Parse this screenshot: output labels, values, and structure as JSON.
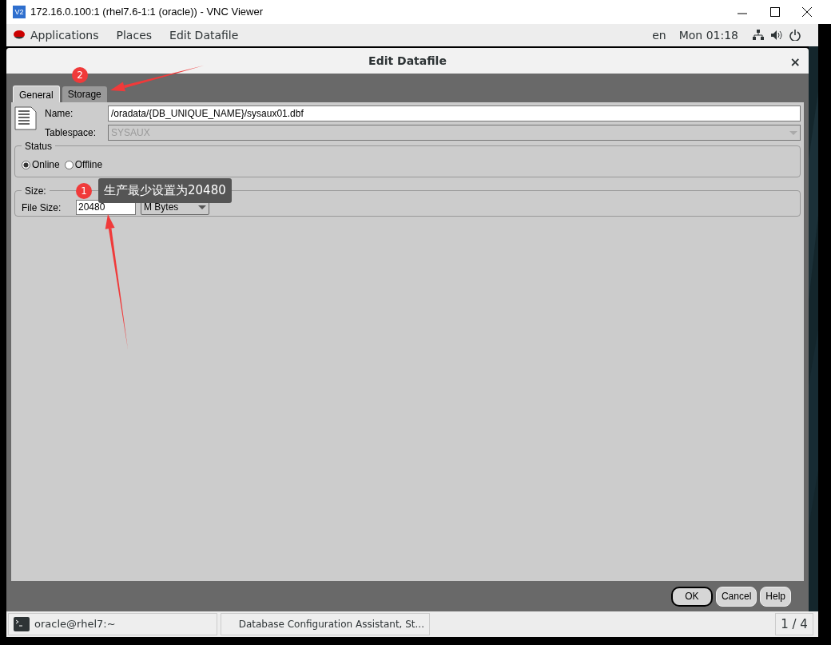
{
  "vnc_window": {
    "app_icon": "V2",
    "title": "172.16.0.100:1 (rhel7.6-1:1 (oracle)) - VNC Viewer"
  },
  "top_bar": {
    "menus": [
      "Applications",
      "Places",
      "Edit Datafile"
    ],
    "language": "en",
    "clock": "Mon 01:18"
  },
  "dialog": {
    "title": "Edit Datafile",
    "close": "×",
    "tabs": [
      {
        "label": "General",
        "selected": true
      },
      {
        "label": "Storage",
        "selected": false
      }
    ],
    "name": {
      "label": "Name:",
      "value": "/oradata/{DB_UNIQUE_NAME}/sysaux01.dbf"
    },
    "tablespace": {
      "label": "Tablespace:",
      "value": "SYSAUX",
      "disabled": true
    },
    "status": {
      "legend": "Status",
      "options": [
        {
          "label": "Online",
          "selected": true
        },
        {
          "label": "Offline",
          "selected": false
        }
      ]
    },
    "size": {
      "legend": "Size:",
      "file_size_label": "File Size:",
      "file_size": "20480",
      "unit": "M Bytes"
    },
    "buttons": [
      {
        "label": "OK",
        "default": true
      },
      {
        "label": "Cancel",
        "default": false
      },
      {
        "label": "Help",
        "default": false
      }
    ]
  },
  "annotations": [
    {
      "number": "1",
      "note": "生产最少设置为20480"
    },
    {
      "number": "2"
    }
  ],
  "taskbar": {
    "items": [
      "oracle@rhel7:~",
      "Database Configuration Assistant, St..."
    ],
    "workspace": "1 / 4"
  }
}
